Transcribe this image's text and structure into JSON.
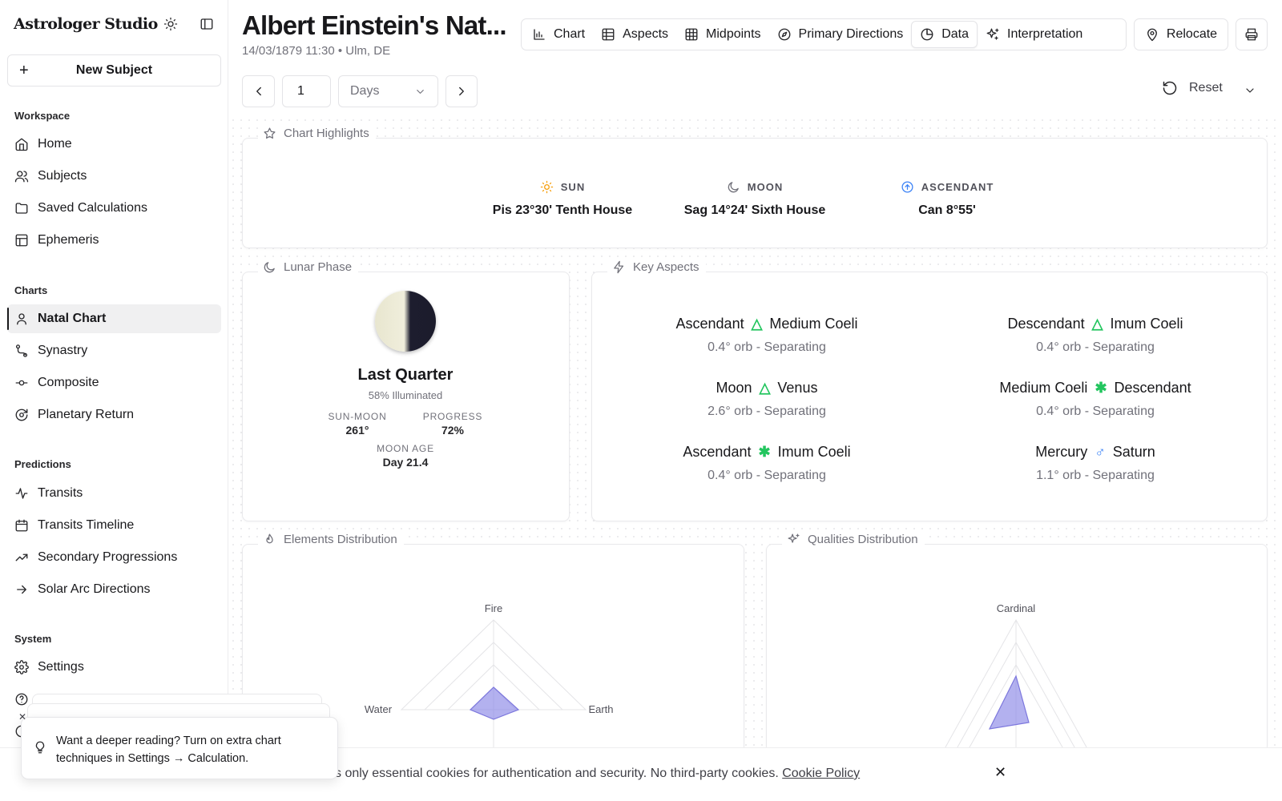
{
  "app": {
    "brand": "Astrologer Studio"
  },
  "sidebar": {
    "new_subject": "New Subject",
    "sections": {
      "workspace": "Workspace",
      "charts": "Charts",
      "predictions": "Predictions",
      "system": "System"
    },
    "workspace": [
      "Home",
      "Subjects",
      "Saved Calculations",
      "Ephemeris"
    ],
    "charts": [
      "Natal Chart",
      "Synastry",
      "Composite",
      "Planetary Return"
    ],
    "predictions": [
      "Transits",
      "Transits Timeline",
      "Secondary Progressions",
      "Solar Arc Directions"
    ],
    "system": [
      "Settings"
    ]
  },
  "header": {
    "title": "Albert Einstein's Nat...",
    "subtitle": "14/03/1879 11:30 • Ulm, DE",
    "tabs": [
      "Chart",
      "Aspects",
      "Midpoints",
      "Primary Directions",
      "Data",
      "Interpretation"
    ],
    "active_tab": "Data",
    "relocate": "Relocate"
  },
  "toolbar": {
    "step_value": "1",
    "unit": "Days",
    "reset": "Reset"
  },
  "highlights": {
    "title": "Chart Highlights",
    "sun": {
      "label": "SUN",
      "value": "Pis 23°30' Tenth House"
    },
    "moon": {
      "label": "MOON",
      "value": "Sag 14°24' Sixth House"
    },
    "asc": {
      "label": "ASCENDANT",
      "value": "Can 8°55'"
    }
  },
  "lunar": {
    "title": "Lunar Phase",
    "phase": "Last Quarter",
    "illuminated": "58% Illuminated",
    "sun_moon_label": "SUN-MOON",
    "sun_moon": "261°",
    "progress_label": "PROGRESS",
    "progress": "72%",
    "age_label": "MOON AGE",
    "age": "Day 21.4"
  },
  "aspects": {
    "title": "Key Aspects",
    "items": [
      {
        "a": "Ascendant",
        "sym": "△",
        "b": "Medium Coeli",
        "orb": "0.4° orb - Separating",
        "color": "#22c55e"
      },
      {
        "a": "Descendant",
        "sym": "△",
        "b": "Imum Coeli",
        "orb": "0.4° orb - Separating",
        "color": "#22c55e"
      },
      {
        "a": "Moon",
        "sym": "△",
        "b": "Venus",
        "orb": "2.6° orb - Separating",
        "color": "#22c55e"
      },
      {
        "a": "Medium Coeli",
        "sym": "✱",
        "b": "Descendant",
        "orb": "0.4° orb - Separating",
        "color": "#22c55e"
      },
      {
        "a": "Ascendant",
        "sym": "✱",
        "b": "Imum Coeli",
        "orb": "0.4° orb - Separating",
        "color": "#22c55e"
      },
      {
        "a": "Mercury",
        "sym": "♂",
        "b": "Saturn",
        "orb": "1.1° orb - Separating",
        "color": "#3b82f6"
      }
    ]
  },
  "elements": {
    "title": "Elements Distribution",
    "labels": {
      "fire": "Fire",
      "earth": "Earth",
      "water": "Water"
    }
  },
  "qualities": {
    "title": "Qualities Distribution",
    "labels": {
      "cardinal": "Cardinal"
    }
  },
  "toast": {
    "text_line1": "Want a deeper reading? Turn on extra chart",
    "text_line2": "techniques in Settings → Calculation."
  },
  "cookie": {
    "text": "s only essential cookies for authentication and security. No third-party cookies.",
    "link": "Cookie Policy"
  },
  "colors": {
    "accent": "#8b87e6",
    "aspect_green": "#22c55e",
    "aspect_blue": "#3b82f6",
    "sun": "#f59e0b"
  }
}
